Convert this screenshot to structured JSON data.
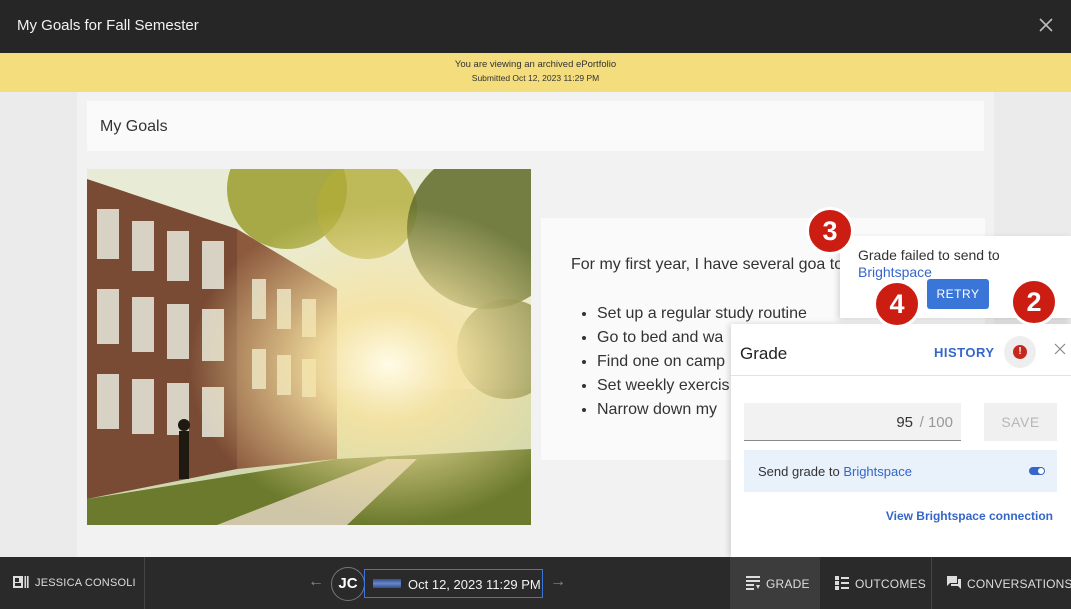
{
  "window": {
    "title": "My Goals for Fall Semester"
  },
  "banner": {
    "line1": "You are viewing an archived ePortfolio",
    "line2": "Submitted Oct 12, 2023 11:29 PM"
  },
  "portfolio": {
    "heading": "My Goals",
    "intro": "For my first year, I have several goa to achieve:",
    "goals": [
      "Set up a regular study routine",
      "Go to bed and wa",
      "Find one on camp",
      "Set weekly exercis",
      "Narrow down my"
    ]
  },
  "error_popover": {
    "message": "Grade failed to send to",
    "link": "Brightspace",
    "retry_label": "RETRY"
  },
  "grade_panel": {
    "title": "Grade",
    "history_label": "HISTORY",
    "alert_glyph": "!",
    "score": "95",
    "out_of": "/ 100",
    "save_label": "SAVE",
    "send_label": "Send grade to",
    "send_link": "Brightspace",
    "send_enabled": true,
    "view_connection_label": "View Brightspace connection"
  },
  "callouts": [
    "3",
    "4",
    "2"
  ],
  "bottom_bar": {
    "student_name": "JESSICA CONSOLI",
    "prev_arrow": "←",
    "next_arrow": "→",
    "avatar_initials": "JC",
    "submission_date": "Oct 12, 2023 11:29 PM",
    "tabs": [
      {
        "label": "GRADE",
        "icon": "grade-icon",
        "active": true
      },
      {
        "label": "OUTCOMES",
        "icon": "outcomes-icon",
        "active": false
      },
      {
        "label": "CONVERSATIONS",
        "icon": "conversations-icon",
        "active": false
      }
    ]
  },
  "colors": {
    "topbar": "#262626",
    "banner": "#f3dd7c",
    "accent": "#3566c9",
    "callout": "#cc1d12",
    "error": "#c6281e"
  }
}
